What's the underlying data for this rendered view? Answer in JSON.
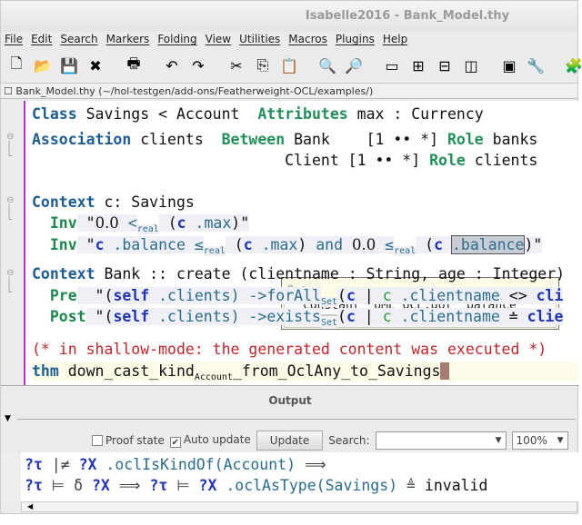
{
  "window": {
    "title": "Isabelle2016 - Bank_Model.thy"
  },
  "menu": [
    "File",
    "Edit",
    "Search",
    "Markers",
    "Folding",
    "View",
    "Utilities",
    "Macros",
    "Plugins",
    "Help"
  ],
  "toolbar": [
    {
      "icon": "new-file-icon",
      "g": "🗋"
    },
    {
      "icon": "open-icon",
      "g": "📂"
    },
    {
      "icon": "save-icon",
      "g": "💾"
    },
    {
      "icon": "close-file-icon",
      "g": "✖"
    },
    {
      "icon": "print-icon",
      "g": "🖶"
    },
    {
      "icon": "undo-icon",
      "g": "↶"
    },
    {
      "icon": "redo-icon",
      "g": "↷"
    },
    {
      "icon": "cut-icon",
      "g": "✂"
    },
    {
      "icon": "copy-icon",
      "g": "⎘"
    },
    {
      "icon": "paste-icon",
      "g": "📋"
    },
    {
      "icon": "find-icon",
      "g": "🔍"
    },
    {
      "icon": "find-replace-icon",
      "g": "🔎"
    },
    {
      "icon": "new-view-icon",
      "g": "▭"
    },
    {
      "icon": "split-icon",
      "g": "⊞"
    },
    {
      "icon": "split-horizontal-icon",
      "g": "⊟"
    },
    {
      "icon": "split-vertical-icon",
      "g": "◫"
    },
    {
      "icon": "options-icon",
      "g": "▣"
    },
    {
      "icon": "tools-icon",
      "g": "🔧"
    },
    {
      "icon": "plugin-icon",
      "g": "🧩"
    }
  ],
  "path": "Bank_Model.thy (~/hol-testgen/add-ons/Featherweight-OCL/examples/)",
  "editor": {
    "lines": [
      {
        "segs": [
          {
            "t": "Class",
            "c": "kw1"
          },
          {
            "t": " Savings < Account  "
          },
          {
            "t": "Attributes",
            "c": "kw2"
          },
          {
            "t": " max : Currency"
          }
        ]
      },
      {
        "segs": [
          {
            "t": "Association",
            "c": "kw1"
          },
          {
            "t": " clients  "
          },
          {
            "t": "Between",
            "c": "kw2"
          },
          {
            "t": " Bank    [1 •• *] "
          },
          {
            "t": "Role",
            "c": "kw2"
          },
          {
            "t": " banks"
          }
        ]
      },
      {
        "segs": [
          {
            "t": "                            Client [1 •• *] "
          },
          {
            "t": "Role",
            "c": "kw2"
          },
          {
            "t": " clients"
          }
        ]
      },
      {
        "segs": [
          {
            "t": "Context",
            "c": "kw1"
          },
          {
            "t": " c: Savings"
          }
        ]
      },
      {
        "segs": [
          {
            "t": "  "
          },
          {
            "t": "Inv",
            "c": "kw3"
          },
          {
            "t": " \"",
            "c": "str"
          },
          {
            "t": "0.0",
            "c": "str num"
          },
          {
            "t": " <",
            "c": "str cst"
          },
          {
            "t": "real",
            "c": "str cst sub"
          },
          {
            "t": " (",
            "c": "str"
          },
          {
            "t": "c",
            "c": "str var"
          },
          {
            "t": " .max",
            "c": "str cst"
          },
          {
            "t": ")\"",
            "c": "str"
          }
        ]
      },
      {
        "segs": [
          {
            "t": "  "
          },
          {
            "t": "Inv",
            "c": "kw3"
          },
          {
            "t": " \"",
            "c": "str"
          },
          {
            "t": "c",
            "c": "str var"
          },
          {
            "t": " .balance ",
            "c": "str cst"
          },
          {
            "t": "≤",
            "c": "str cst"
          },
          {
            "t": "real",
            "c": "str cst sub"
          },
          {
            "t": " (",
            "c": "str"
          },
          {
            "t": "c",
            "c": "str var"
          },
          {
            "t": " .max",
            "c": "str cst"
          },
          {
            "t": ") ",
            "c": "str"
          },
          {
            "t": "and",
            "c": "str cst"
          },
          {
            "t": " ",
            "c": "str"
          },
          {
            "t": "0.0",
            "c": "str num"
          },
          {
            "t": " ≤",
            "c": "str cst"
          },
          {
            "t": "real",
            "c": "str cst sub"
          },
          {
            "t": " (",
            "c": "str"
          },
          {
            "t": "c",
            "c": "str var"
          },
          {
            "t": " ",
            "c": "str"
          },
          {
            "t": ".balance",
            "c": "str cst sel"
          },
          {
            "t": ")\"",
            "c": "str"
          }
        ]
      },
      {
        "segs": [
          {
            "t": "Context",
            "c": "kw1"
          },
          {
            "t": " Bank :: create (clientname : String, age : Integer)"
          }
        ]
      },
      {
        "segs": [
          {
            "t": "  "
          },
          {
            "t": "Pre",
            "c": "kw3"
          },
          {
            "t": "  \"(",
            "c": "str"
          },
          {
            "t": "self",
            "c": "str var"
          },
          {
            "t": " .clients",
            "c": "str cst"
          },
          {
            "t": ") ->forAll",
            "c": "str cst"
          },
          {
            "t": "Set",
            "c": "str cst sub"
          },
          {
            "t": "(",
            "c": "str"
          },
          {
            "t": "c",
            "c": "str var"
          },
          {
            "t": " | ",
            "c": "str"
          },
          {
            "t": "c",
            "c": "str fv"
          },
          {
            "t": " .clientname",
            "c": "str cst"
          },
          {
            "t": " <> ",
            "c": "str"
          },
          {
            "t": "cli",
            "c": "str var"
          }
        ]
      },
      {
        "segs": [
          {
            "t": "  "
          },
          {
            "t": "Post",
            "c": "kw3"
          },
          {
            "t": " \"(",
            "c": "str"
          },
          {
            "t": "self",
            "c": "str var"
          },
          {
            "t": " .clients",
            "c": "str cst"
          },
          {
            "t": ") ->exists",
            "c": "str cst"
          },
          {
            "t": "Set",
            "c": "str cst sub"
          },
          {
            "t": "(",
            "c": "str"
          },
          {
            "t": "c",
            "c": "str var"
          },
          {
            "t": " | ",
            "c": "str"
          },
          {
            "t": "c",
            "c": "str fv"
          },
          {
            "t": " .clientname",
            "c": "str cst"
          },
          {
            "t": " ≐ ",
            "c": "str"
          },
          {
            "t": "clie",
            "c": "str var"
          }
        ]
      },
      {
        "segs": [
          {
            "t": "(* in shallow-mode: the generated content was executed *)",
            "c": "cmt"
          }
        ]
      },
      {
        "segs": [
          {
            "t": "thm",
            "c": "kw1"
          },
          {
            "t": " down_cast_kind"
          },
          {
            "t": "Account",
            "c": "sub"
          },
          {
            "t": "_from_OclAny_to_Savings"
          }
        ]
      }
    ]
  },
  "popup": {
    "text": "constant \"UML_OCL.dot__balance\""
  },
  "output": {
    "title": "Output",
    "proof_state_label": "Proof state",
    "proof_state_checked": false,
    "auto_update_label": "Auto update",
    "auto_update_checked": true,
    "update_button": "Update",
    "search_label": "Search:",
    "search_value": "",
    "zoom": "100%",
    "lines": [
      [
        {
          "t": "?τ",
          "c": "oschem"
        },
        {
          "t": " |≠ ",
          "c": "osym"
        },
        {
          "t": "?X",
          "c": "oschem"
        },
        {
          "t": " .oclIsKindOf(Account)",
          "c": "ocst"
        },
        {
          "t": " ⟹",
          "c": "osym"
        }
      ],
      [
        {
          "t": "?τ",
          "c": "oschem"
        },
        {
          "t": " ⊨ δ ",
          "c": "osym"
        },
        {
          "t": "?X",
          "c": "oschem"
        },
        {
          "t": " ⟹ ",
          "c": "osym"
        },
        {
          "t": "?τ",
          "c": "oschem"
        },
        {
          "t": " ⊨ ",
          "c": "osym"
        },
        {
          "t": "?X",
          "c": "oschem"
        },
        {
          "t": " .oclAsType(Savings)",
          "c": "ocst"
        },
        {
          "t": " ≜ ",
          "c": "osym"
        },
        {
          "t": "invalid"
        }
      ]
    ]
  }
}
